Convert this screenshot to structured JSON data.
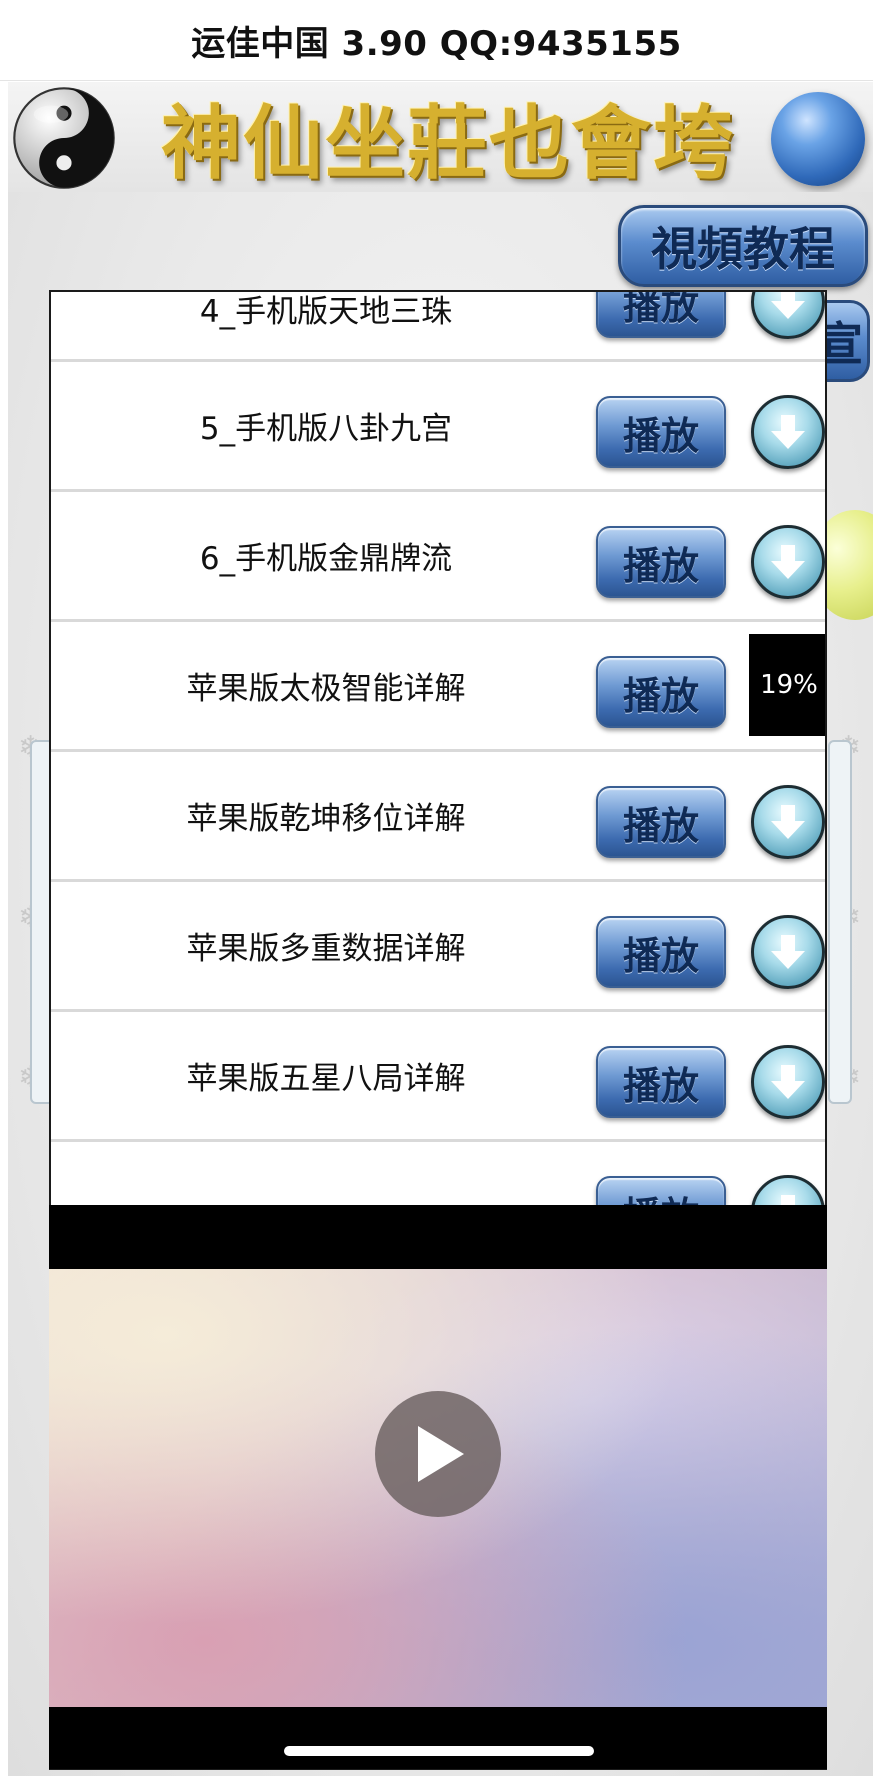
{
  "status_title": "运佳中国 3.90 QQ:9435155",
  "banner": {
    "title": "神仙坐莊也會垮"
  },
  "background": {
    "tutorial_button": "視頻教程",
    "peek_button": "宣"
  },
  "list": {
    "play_label": "播放",
    "items": [
      {
        "title": "4_手机版天地三珠",
        "download_state": "icon"
      },
      {
        "title": "5_手机版八卦九宫",
        "download_state": "icon"
      },
      {
        "title": "6_手机版金鼎牌流",
        "download_state": "icon"
      },
      {
        "title": "苹果版太极智能详解",
        "download_state": "progress",
        "progress": "19%"
      },
      {
        "title": "苹果版乾坤移位详解",
        "download_state": "icon"
      },
      {
        "title": "苹果版多重数据详解",
        "download_state": "icon"
      },
      {
        "title": "苹果版五星八局详解",
        "download_state": "icon"
      }
    ]
  },
  "icons": {
    "download": "download-arrow-icon",
    "video_play": "play-triangle-icon",
    "logo": "yin-yang-icon"
  },
  "colors": {
    "button_blue": "#5b8cce",
    "banner_gold": "#d6b02f",
    "divider": "#d9d9d9"
  }
}
